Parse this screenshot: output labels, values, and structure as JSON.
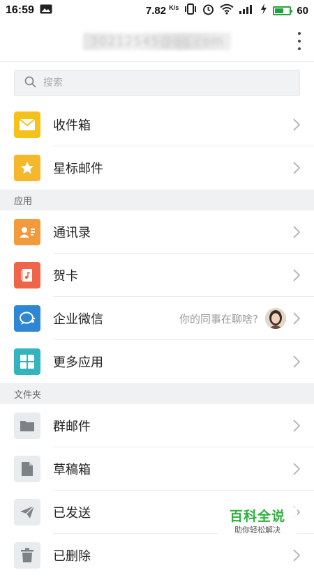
{
  "status_bar": {
    "time": "16:59",
    "net_speed": "7.82",
    "net_unit": "K/s",
    "battery": "60",
    "battery_level": 0.6,
    "battery_color": "#22a33a"
  },
  "header": {
    "account": "30212545@qq.com"
  },
  "search": {
    "placeholder": "搜索"
  },
  "mailbox": [
    {
      "label": "收件箱",
      "icon": "envelope-icon",
      "color": "#f5c21b"
    },
    {
      "label": "星标邮件",
      "icon": "star-icon",
      "color": "#f5b82a"
    }
  ],
  "apps_section": {
    "title": "应用",
    "items": [
      {
        "label": "通讯录",
        "icon": "contact-card-icon",
        "color": "#f29a3e"
      },
      {
        "label": "贺卡",
        "icon": "greeting-card-icon",
        "color": "#ef6549"
      },
      {
        "label": "企业微信",
        "icon": "work-chat-icon",
        "color": "#2f86d4",
        "hint": "你的同事在聊啥?"
      },
      {
        "label": "更多应用",
        "icon": "grid-icon",
        "color": "#32b5bf"
      }
    ]
  },
  "folders_section": {
    "title": "文件夹",
    "items": [
      {
        "label": "群邮件",
        "icon": "folder-icon",
        "color": "#e9ecef"
      },
      {
        "label": "草稿箱",
        "icon": "draft-icon",
        "color": "#e9ecef"
      },
      {
        "label": "已发送",
        "icon": "paper-plane-icon",
        "color": "#e9ecef"
      },
      {
        "label": "已删除",
        "icon": "trash-icon",
        "color": "#e9ecef"
      }
    ]
  },
  "watermark": {
    "title": "百科全说",
    "subtitle": "助你轻松解决"
  }
}
